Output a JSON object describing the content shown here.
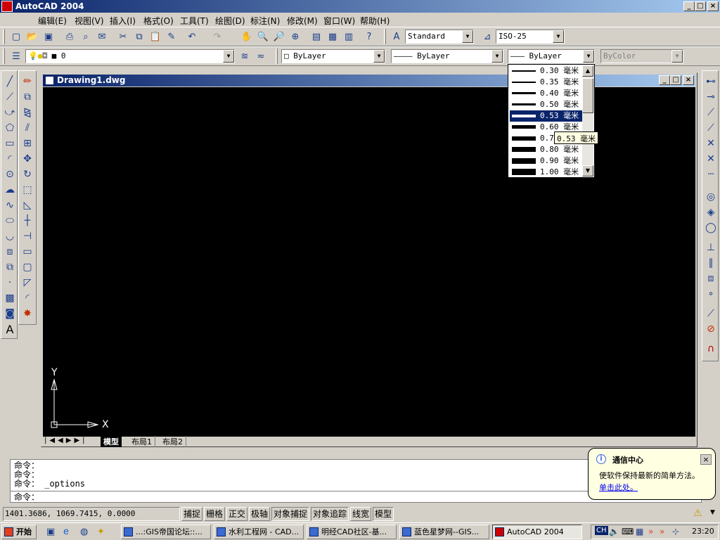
{
  "app": {
    "title": "AutoCAD 2004",
    "min": "_",
    "max": "□",
    "close": "×"
  },
  "menu": [
    "编辑(E)",
    "视图(V)",
    "插入(I)",
    "格式(O)",
    "工具(T)",
    "绘图(D)",
    "标注(N)",
    "修改(M)",
    "窗口(W)",
    "帮助(H)"
  ],
  "toolbar": {
    "text_style": "Standard",
    "dim_style": "ISO-25",
    "layer": "0",
    "color": "ByLayer",
    "linetype": "ByLayer",
    "lineweight": "ByLayer",
    "plotstyle": "ByColor"
  },
  "drawing": {
    "title": "Drawing1.dwg",
    "axis_y": "Y",
    "axis_x": "X",
    "tabs": [
      "模型",
      "布局1",
      "布局2"
    ]
  },
  "lineweight_list": [
    {
      "label": "0.30 毫米",
      "weight": 2
    },
    {
      "label": "0.35 毫米",
      "weight": 2
    },
    {
      "label": "0.40 毫米",
      "weight": 3
    },
    {
      "label": "0.50 毫米",
      "weight": 3
    },
    {
      "label": "0.53 毫米",
      "weight": 4,
      "selected": true
    },
    {
      "label": "0.60 毫米",
      "weight": 5
    },
    {
      "label": "0.70 毫米",
      "weight": 6
    },
    {
      "label": "0.80 毫米",
      "weight": 7
    },
    {
      "label": "0.90 毫米",
      "weight": 8
    },
    {
      "label": "1.00 毫米",
      "weight": 9
    }
  ],
  "tooltip": "0.53 毫米",
  "command": {
    "lines": [
      "命令：",
      "命令：",
      "命令： _options"
    ],
    "prompt": "命令："
  },
  "notification": {
    "title": "通信中心",
    "body": "使软件保持最新的简单方法。",
    "link": "单击此处。",
    "close": "×"
  },
  "status": {
    "coords": "1401.3686, 1069.7415, 0.0000",
    "buttons": [
      "捕捉",
      "栅格",
      "正交",
      "极轴",
      "对象捕捉",
      "对象追踪",
      "线宽",
      "模型"
    ]
  },
  "taskbar": {
    "start": "开始",
    "tasks": [
      "...:GIS帝国论坛::...",
      "水利工程网 - CAD...",
      "明经CAD社区-基...",
      "蓝色星梦网--GIS...",
      "AutoCAD 2004"
    ],
    "lang": "CH",
    "clock": "23:20"
  },
  "colors": {
    "titlebar": "#0a246a",
    "canvas": "#000000",
    "face": "#d4d0c8",
    "tooltip_bg": "#ffffe1"
  }
}
